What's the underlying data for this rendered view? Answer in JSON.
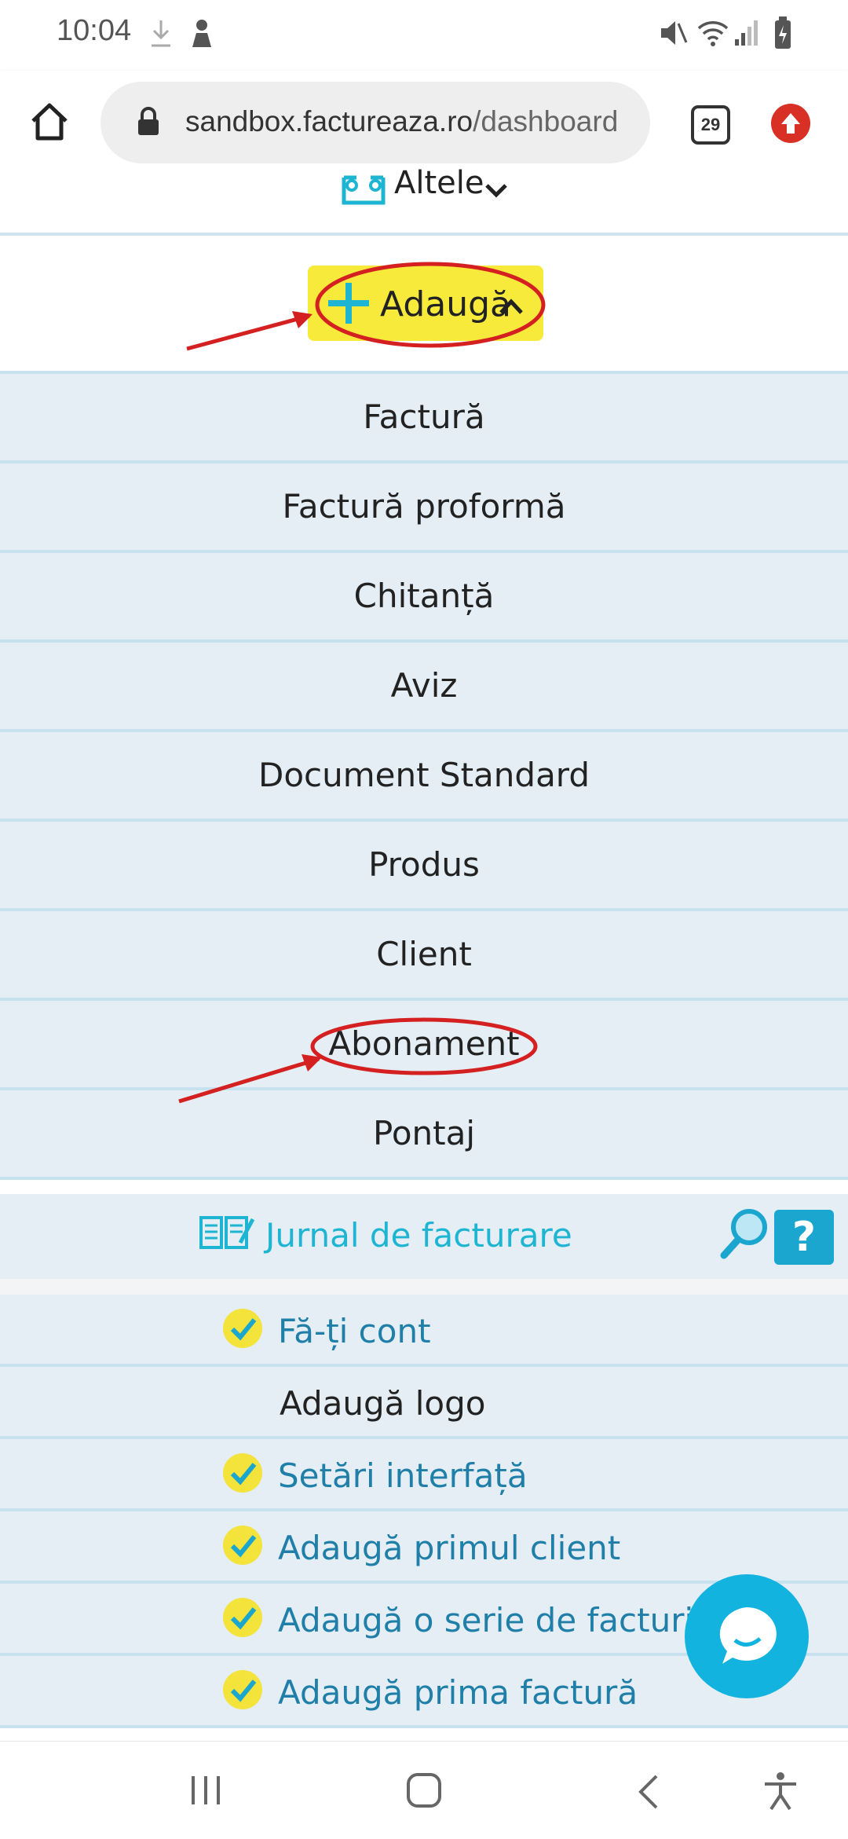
{
  "status_bar": {
    "time": "10:04"
  },
  "browser": {
    "url_host": "sandbox.factureaza.ro",
    "url_path": "/dashboard",
    "tab_count": "29"
  },
  "menu": {
    "altele_label": "Altele",
    "add_label": "Adaugă",
    "items": [
      {
        "label": "Factură"
      },
      {
        "label": "Factură proformă"
      },
      {
        "label": "Chitanță"
      },
      {
        "label": "Aviz"
      },
      {
        "label": "Document Standard"
      },
      {
        "label": "Produs"
      },
      {
        "label": "Client"
      },
      {
        "label": "Abonament"
      },
      {
        "label": "Pontaj"
      }
    ]
  },
  "journal": {
    "title": "Jurnal de facturare",
    "help_label": "?",
    "tasks": [
      {
        "label": "Fă-ți cont",
        "done": true
      },
      {
        "label": "Adaugă logo",
        "done": false
      },
      {
        "label": "Setări interfață",
        "done": true
      },
      {
        "label": "Adaugă primul client",
        "done": true
      },
      {
        "label": "Adaugă o serie de facturi",
        "done": true
      },
      {
        "label": "Adaugă prima factură",
        "done": true
      }
    ]
  },
  "colors": {
    "accent": "#1db5d2",
    "highlight": "#f7ea3b",
    "annotation": "#d42020"
  }
}
